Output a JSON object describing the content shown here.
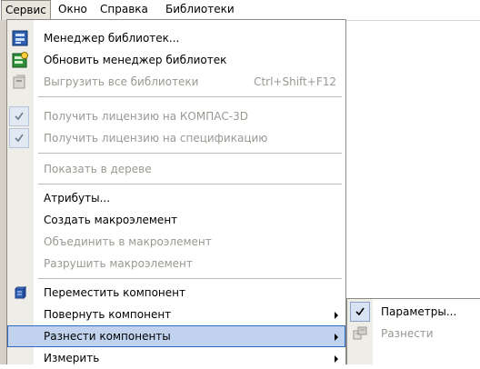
{
  "menubar": {
    "items": [
      {
        "label": "Сервис",
        "active": true
      },
      {
        "label": "Окно"
      },
      {
        "label": "Справка"
      },
      {
        "label": "Библиотеки"
      }
    ]
  },
  "dropdown": {
    "items": [
      {
        "label": "Менеджер библиотек...",
        "icon": "library-manager-icon",
        "enabled": true
      },
      {
        "label": "Обновить менеджер библиотек",
        "icon": "refresh-library-icon",
        "enabled": true
      },
      {
        "label": "Выгрузить все библиотеки",
        "shortcut": "Ctrl+Shift+F12",
        "icon": "unload-libraries-icon",
        "enabled": false
      },
      {
        "label": "Получить лицензию на КОМПАС-3D",
        "checked": true,
        "enabled": false
      },
      {
        "label": "Получить лицензию на спецификацию",
        "checked": true,
        "enabled": false
      },
      {
        "label": "Показать в дереве",
        "enabled": false
      },
      {
        "label": "Атрибуты...",
        "enabled": true
      },
      {
        "label": "Создать макроэлемент",
        "enabled": true
      },
      {
        "label": "Объединить в макроэлемент",
        "enabled": false
      },
      {
        "label": "Разрушить макроэлемент",
        "enabled": false
      },
      {
        "label": "Переместить компонент",
        "icon": "move-component-icon",
        "enabled": true
      },
      {
        "label": "Повернуть компонент",
        "submenu": true,
        "enabled": true
      },
      {
        "label": "Разнести компоненты",
        "submenu": true,
        "highlighted": true,
        "enabled": true
      },
      {
        "label": "Измерить",
        "submenu": true,
        "enabled": true
      }
    ]
  },
  "submenu": {
    "items": [
      {
        "label": "Параметры...",
        "checked": true,
        "enabled": true
      },
      {
        "label": "Разнести",
        "icon": "explode-icon",
        "enabled": false
      }
    ]
  },
  "colors": {
    "highlight_bg": "#c1d2ee",
    "highlight_border": "#316ac5",
    "gutter": "#efede7",
    "disabled_text": "#9a9891"
  }
}
